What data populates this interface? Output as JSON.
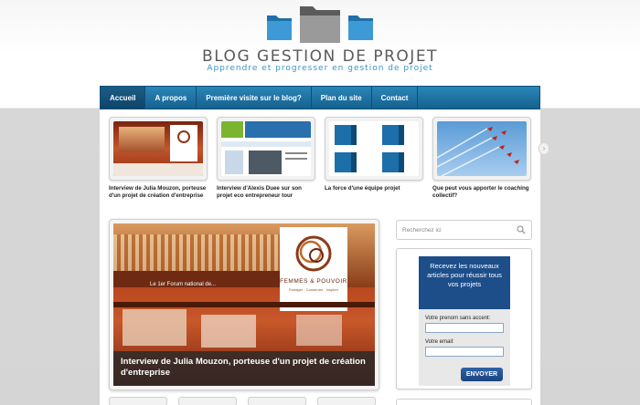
{
  "header": {
    "title": "BLOG GESTION DE PROJET",
    "subtitle": "Apprendre et progresser en gestion de projet"
  },
  "nav": {
    "items": [
      {
        "label": "Accueil",
        "active": true
      },
      {
        "label": "A propos",
        "active": false
      },
      {
        "label": "Première visite sur le blog?",
        "active": false
      },
      {
        "label": "Plan du site",
        "active": false
      },
      {
        "label": "Contact",
        "active": false
      }
    ]
  },
  "thumbs": [
    {
      "caption": "Interview de Julia Mouzon, porteuse d'un projet de création d'entreprise",
      "icon": "conference-hall-image"
    },
    {
      "caption": "Interview d'Alexis Duee sur son projet eco entrepreneur tour",
      "icon": "eco-tour-website-image"
    },
    {
      "caption": "La force d'une équipe projet",
      "icon": "team-blocks-image"
    },
    {
      "caption": "Que peut vous apporter le coaching collectif?",
      "icon": "jet-formation-image"
    }
  ],
  "feature": {
    "caption": "Interview de Julia Mouzon, porteuse d'un projet de création d'entreprise",
    "brand_name": "FEMMES & POUVOIR",
    "brand_tagline": "Partager · Construire · Inspirer",
    "forum_text": "Le 1er Forum national de..."
  },
  "search": {
    "placeholder": "Recherchez ici"
  },
  "newsletter": {
    "heading": "Recevez les nouveaux articles pour réussir tous vos projets",
    "name_label": "Votre prenom sans accent:",
    "email_label": "Votre email:",
    "button": "ENVOYER"
  },
  "colors": {
    "accent": "#1e76a8",
    "newsletter_bg": "#1d4e8a"
  }
}
